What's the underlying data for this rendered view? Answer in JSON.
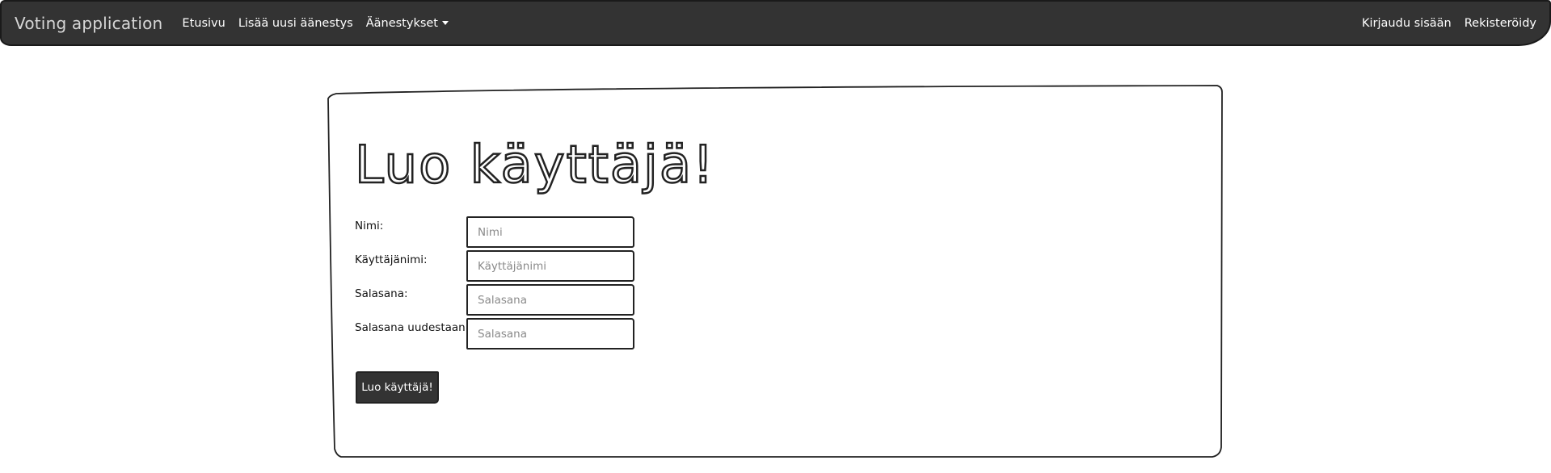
{
  "navbar": {
    "brand": "Voting application",
    "links": [
      {
        "label": "Etusivu"
      },
      {
        "label": "Lisää uusi äänestys"
      },
      {
        "label": "Äänestykset"
      }
    ],
    "right_links": [
      {
        "label": "Kirjaudu sisään"
      },
      {
        "label": "Rekisteröidy"
      }
    ],
    "dropdown_icon": "caret-down-icon"
  },
  "form": {
    "title": "Luo käyttäjä!",
    "fields": [
      {
        "label": "Nimi:",
        "placeholder": "Nimi",
        "value": ""
      },
      {
        "label": "Käyttäjänimi:",
        "placeholder": "Käyttäjänimi",
        "value": ""
      },
      {
        "label": "Salasana:",
        "placeholder": "Salasana",
        "value": ""
      },
      {
        "label": "Salasana uudestaan:",
        "placeholder": "Salasana",
        "value": ""
      }
    ],
    "submit_label": "Luo käyttäjä!"
  },
  "colors": {
    "navbar_bg": "#333333",
    "button_bg": "#333333",
    "text": "#212121"
  }
}
